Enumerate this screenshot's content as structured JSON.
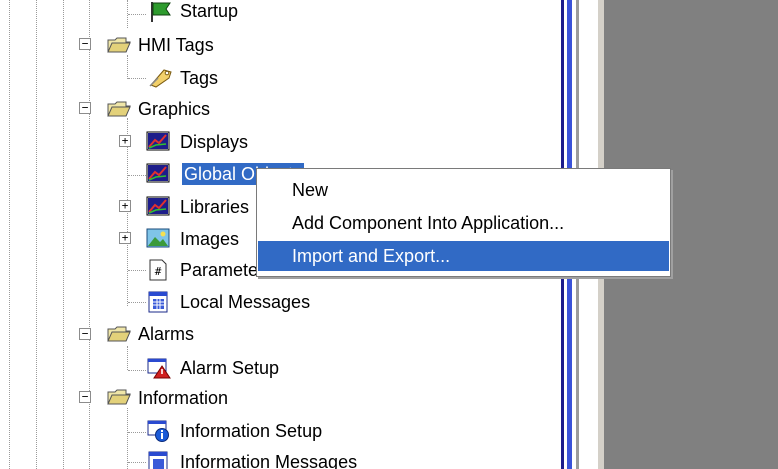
{
  "tree": {
    "items": [
      {
        "label": "Startup",
        "icon": "startup-flag-icon"
      },
      {
        "label": "HMI Tags",
        "icon": "folder-icon",
        "expander": "−"
      },
      {
        "label": "Tags",
        "icon": "tag-icon"
      },
      {
        "label": "Graphics",
        "icon": "folder-icon",
        "expander": "−"
      },
      {
        "label": "Displays",
        "icon": "display-icon",
        "expander": "+"
      },
      {
        "label": "Global Objects",
        "icon": "display-icon",
        "selected": true
      },
      {
        "label": "Libraries",
        "icon": "display-icon",
        "expander": "+"
      },
      {
        "label": "Images",
        "icon": "image-icon",
        "expander": "+"
      },
      {
        "label": "Parameters",
        "icon": "parameter-icon"
      },
      {
        "label": "Local Messages",
        "icon": "messages-icon"
      },
      {
        "label": "Alarms",
        "icon": "folder-icon",
        "expander": "−"
      },
      {
        "label": "Alarm Setup",
        "icon": "alarm-icon"
      },
      {
        "label": "Information",
        "icon": "folder-icon",
        "expander": "−"
      },
      {
        "label": "Information Setup",
        "icon": "info-icon"
      },
      {
        "label": "Information Messages",
        "icon": "messages-icon"
      }
    ]
  },
  "context_menu": {
    "items": [
      {
        "label": "New"
      },
      {
        "label": "Add Component Into Application..."
      },
      {
        "label": "Import and Export...",
        "highlighted": true
      }
    ]
  },
  "colors": {
    "selection": "#316ac5",
    "workspace": "#808080",
    "splitter_blue": "#3a52d8"
  }
}
